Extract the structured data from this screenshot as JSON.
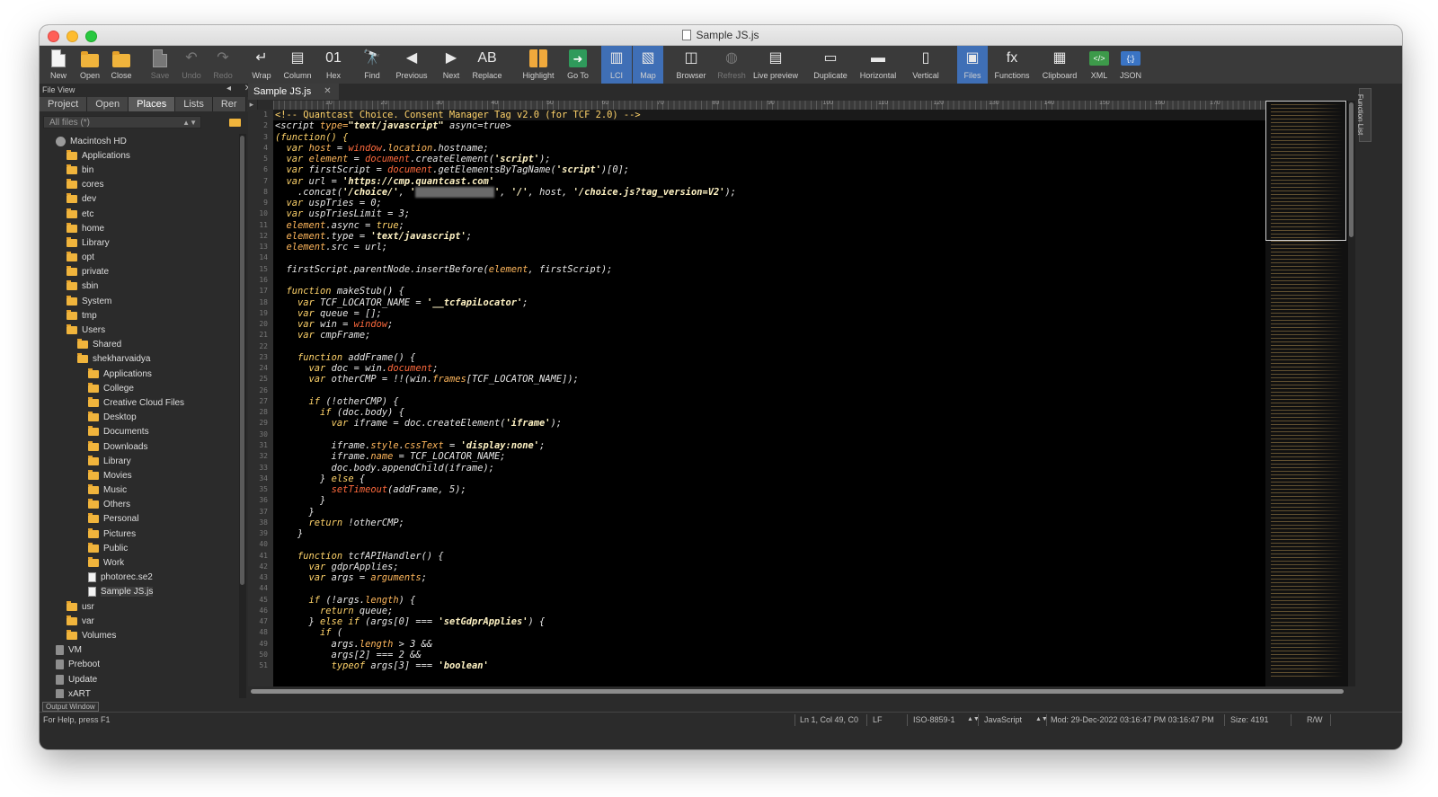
{
  "window": {
    "title": "Sample JS.js"
  },
  "toolbar": [
    {
      "label": "New",
      "icon": "new-file-icon"
    },
    {
      "label": "Open",
      "icon": "open-folder-icon"
    },
    {
      "label": "Close",
      "icon": "close-folder-icon"
    },
    {
      "label": "Save",
      "icon": "save-icon",
      "disabled": true
    },
    {
      "label": "Undo",
      "icon": "undo-icon",
      "disabled": true
    },
    {
      "label": "Redo",
      "icon": "redo-icon",
      "disabled": true
    },
    {
      "label": "Wrap",
      "icon": "wrap-icon"
    },
    {
      "label": "Column",
      "icon": "column-icon"
    },
    {
      "label": "Hex",
      "icon": "hex-icon"
    },
    {
      "label": "Find",
      "icon": "find-icon"
    },
    {
      "label": "Previous",
      "icon": "previous-icon"
    },
    {
      "label": "Next",
      "icon": "next-icon"
    },
    {
      "label": "Replace",
      "icon": "replace-icon"
    },
    {
      "label": "Highlight",
      "icon": "highlight-icon"
    },
    {
      "label": "Go To",
      "icon": "goto-icon"
    },
    {
      "label": "LCI",
      "icon": "lci-icon",
      "active": true
    },
    {
      "label": "Map",
      "icon": "map-icon",
      "active": true
    },
    {
      "label": "Browser",
      "icon": "browser-icon"
    },
    {
      "label": "Refresh",
      "icon": "refresh-icon",
      "disabled": true
    },
    {
      "label": "Live preview",
      "icon": "live-preview-icon"
    },
    {
      "label": "Duplicate",
      "icon": "duplicate-icon"
    },
    {
      "label": "Horizontal",
      "icon": "horizontal-icon"
    },
    {
      "label": "Vertical",
      "icon": "vertical-icon"
    },
    {
      "label": "Files",
      "icon": "files-icon",
      "active": true
    },
    {
      "label": "Functions",
      "icon": "functions-icon"
    },
    {
      "label": "Clipboard",
      "icon": "clipboard-icon"
    },
    {
      "label": "XML",
      "icon": "xml-icon"
    },
    {
      "label": "JSON",
      "icon": "json-icon"
    }
  ],
  "sidebar": {
    "header": "File View",
    "tabs": [
      "Project",
      "Open",
      "Places",
      "Lists",
      "Rer"
    ],
    "active_tab": "Places",
    "filter": "All files (*)",
    "tree": [
      {
        "label": "Macintosh HD",
        "indent": 1,
        "type": "disk"
      },
      {
        "label": "Applications",
        "indent": 2,
        "type": "folder"
      },
      {
        "label": "bin",
        "indent": 2,
        "type": "folder"
      },
      {
        "label": "cores",
        "indent": 2,
        "type": "folder"
      },
      {
        "label": "dev",
        "indent": 2,
        "type": "folder"
      },
      {
        "label": "etc",
        "indent": 2,
        "type": "folder"
      },
      {
        "label": "home",
        "indent": 2,
        "type": "folder"
      },
      {
        "label": "Library",
        "indent": 2,
        "type": "folder"
      },
      {
        "label": "opt",
        "indent": 2,
        "type": "folder"
      },
      {
        "label": "private",
        "indent": 2,
        "type": "folder"
      },
      {
        "label": "sbin",
        "indent": 2,
        "type": "folder"
      },
      {
        "label": "System",
        "indent": 2,
        "type": "folder"
      },
      {
        "label": "tmp",
        "indent": 2,
        "type": "folder"
      },
      {
        "label": "Users",
        "indent": 2,
        "type": "folder"
      },
      {
        "label": "Shared",
        "indent": 3,
        "type": "folder"
      },
      {
        "label": "shekharvaidya",
        "indent": 3,
        "type": "folder"
      },
      {
        "label": "Applications",
        "indent": 4,
        "type": "folder"
      },
      {
        "label": "College",
        "indent": 4,
        "type": "folder"
      },
      {
        "label": "Creative Cloud Files",
        "indent": 4,
        "type": "folder"
      },
      {
        "label": "Desktop",
        "indent": 4,
        "type": "folder"
      },
      {
        "label": "Documents",
        "indent": 4,
        "type": "folder"
      },
      {
        "label": "Downloads",
        "indent": 4,
        "type": "folder"
      },
      {
        "label": "Library",
        "indent": 4,
        "type": "folder"
      },
      {
        "label": "Movies",
        "indent": 4,
        "type": "folder"
      },
      {
        "label": "Music",
        "indent": 4,
        "type": "folder"
      },
      {
        "label": "Others",
        "indent": 4,
        "type": "folder"
      },
      {
        "label": "Personal",
        "indent": 4,
        "type": "folder"
      },
      {
        "label": "Pictures",
        "indent": 4,
        "type": "folder"
      },
      {
        "label": "Public",
        "indent": 4,
        "type": "folder"
      },
      {
        "label": "Work",
        "indent": 4,
        "type": "folder"
      },
      {
        "label": "photorec.se2",
        "indent": 4,
        "type": "doc"
      },
      {
        "label": "Sample JS.js",
        "indent": 4,
        "type": "doc",
        "selected": true
      },
      {
        "label": "usr",
        "indent": 2,
        "type": "folder"
      },
      {
        "label": "var",
        "indent": 2,
        "type": "folder"
      },
      {
        "label": "Volumes",
        "indent": 2,
        "type": "folder"
      },
      {
        "label": "VM",
        "indent": 1,
        "type": "vol"
      },
      {
        "label": "Preboot",
        "indent": 1,
        "type": "vol"
      },
      {
        "label": "Update",
        "indent": 1,
        "type": "vol"
      },
      {
        "label": "xART",
        "indent": 1,
        "type": "vol"
      }
    ],
    "output_window": "Output Window"
  },
  "editor": {
    "tab": "Sample JS.js",
    "ruler_marks": [
      "10",
      "20",
      "30",
      "40",
      "50",
      "60",
      "70",
      "80",
      "90",
      "100",
      "110",
      "120",
      "130",
      "140",
      "150",
      "160",
      "170",
      "180"
    ],
    "function_list_label": "Function List",
    "lines": [
      "<span class=\"cm\">&lt;!-- Quantcast Choice. Consent Manager Tag v2.0 (for TCF 2.0) --&gt;</span>",
      "&lt;script <span class=\"at\">type=</span><span class=\"str\">\"text/javascript\"</span> async=true&gt;",
      "<span class=\"kw\">(function() {</span>",
      "  <span class=\"kw\">var</span> <span class=\"at\">host</span> = <span class=\"glob\">window</span>.<span class=\"at\">location</span>.hostname;",
      "  <span class=\"kw\">var</span> <span class=\"at\">element</span> = <span class=\"glob\">document</span>.createElement(<span class=\"str\">'script'</span>);",
      "  <span class=\"kw\">var</span> firstScript = <span class=\"glob\">document</span>.getElementsByTagName(<span class=\"str\">'script'</span>)[0];",
      "  <span class=\"kw\">var</span> url = <span class=\"str\">'https://cmp.quantcast.com'</span>",
      "    .concat(<span class=\"str\">'/choice/'</span>, <span class=\"str\">'</span><span class=\"blur\">XXXXXXXXXXXXXX</span><span class=\"str\">'</span>, <span class=\"str\">'/'</span>, host, <span class=\"str\">'/choice.js?tag_version=V2'</span>);",
      "  <span class=\"kw\">var</span> uspTries = 0;",
      "  <span class=\"kw\">var</span> uspTriesLimit = 3;",
      "  <span class=\"at\">element</span>.async = <span class=\"kw\">true</span>;",
      "  <span class=\"at\">element</span>.type = <span class=\"str\">'text/javascript'</span>;",
      "  <span class=\"at\">element</span>.src = url;",
      "",
      "  firstScript.parentNode.insertBefore(<span class=\"at\">element</span>, firstScript);",
      "",
      "  <span class=\"kw\">function</span> makeStub() {",
      "    <span class=\"kw\">var</span> TCF_LOCATOR_NAME = <span class=\"str\">'__tcfapiLocator'</span>;",
      "    <span class=\"kw\">var</span> queue = [];",
      "    <span class=\"kw\">var</span> win = <span class=\"glob\">window</span>;",
      "    <span class=\"kw\">var</span> cmpFrame;",
      "",
      "    <span class=\"kw\">function</span> addFrame() {",
      "      <span class=\"kw\">var</span> doc = win.<span class=\"glob\">document</span>;",
      "      <span class=\"kw\">var</span> otherCMP = !!(win.<span class=\"at\">frames</span>[TCF_LOCATOR_NAME]);",
      "",
      "      <span class=\"kw\">if</span> (!otherCMP) {",
      "        <span class=\"kw\">if</span> (doc.body) {",
      "          <span class=\"kw\">var</span> iframe = doc.createElement(<span class=\"str\">'iframe'</span>);",
      "",
      "          iframe.<span class=\"at\">style</span>.<span class=\"at\">cssText</span> = <span class=\"str\">'display:none'</span>;",
      "          iframe.<span class=\"at\">name</span> = TCF_LOCATOR_NAME;",
      "          doc.body.appendChild(iframe);",
      "        } <span class=\"kw\">else</span> {",
      "          <span class=\"glob\">setTimeout</span>(addFrame, 5);",
      "        }",
      "      }",
      "      <span class=\"kw\">return</span> !otherCMP;",
      "    }",
      "",
      "    <span class=\"kw\">function</span> tcfAPIHandler() {",
      "      <span class=\"kw\">var</span> gdprApplies;",
      "      <span class=\"kw\">var</span> args = <span class=\"at\">arguments</span>;",
      "",
      "      <span class=\"kw\">if</span> (!args.<span class=\"at\">length</span>) {",
      "        <span class=\"kw\">return</span> queue;",
      "      } <span class=\"kw\">else if</span> (args[0] === <span class=\"str\">'setGdprApplies'</span>) {",
      "        <span class=\"kw\">if</span> (",
      "          args.<span class=\"at\">length</span> &gt; 3 &amp;&amp;",
      "          args[2] === 2 &amp;&amp;",
      "          <span class=\"kw\">typeof</span> args[3] === <span class=\"str\">'boolean'</span>"
    ]
  },
  "statusbar": {
    "help": "For Help, press F1",
    "position": "Ln 1, Col 49, C0",
    "line_ending": "LF",
    "encoding": "ISO-8859-1",
    "language": "JavaScript",
    "modified": "Mod: 29-Dec-2022 03:16:47 PM 03:16:47 PM",
    "size": "Size: 4191",
    "mode": "R/W"
  },
  "colors": {
    "keyword": "#ffd36a",
    "string": "#fff3c4",
    "global": "#ff6a3d",
    "accent": "#3f6fb6"
  }
}
